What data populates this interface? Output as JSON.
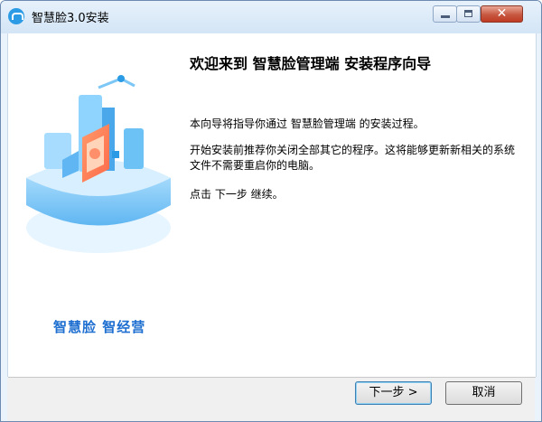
{
  "window": {
    "title": "智慧脸3.0安装"
  },
  "titlebar": {
    "close_glyph": "✕"
  },
  "side": {
    "brand_text": "智慧脸 智经营"
  },
  "main": {
    "heading": "欢迎来到 智慧脸管理端 安装程序向导",
    "para1": "本向导将指导你通过 智慧脸管理端 的安装过程。",
    "para2": "开始安装前推荐你关闭全部其它的程序。这将能够更新新相关的系统文件不需要重启你的电脑。",
    "para3": "点击 下一步 继续。"
  },
  "buttons": {
    "next": "下一步 >",
    "cancel": "取消"
  },
  "colors": {
    "accent": "#2a9be4",
    "brand": "#1f6fd1"
  }
}
